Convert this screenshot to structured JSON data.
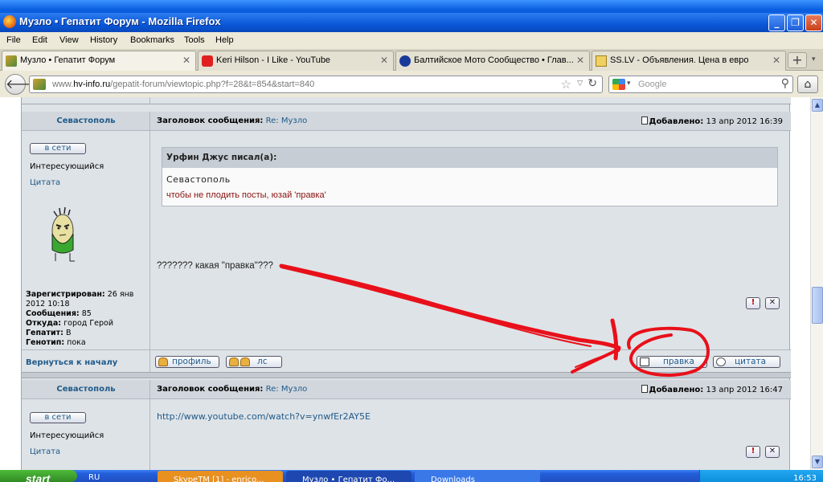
{
  "window": {
    "title": "Музло • Гепатит Форум - Mozilla Firefox"
  },
  "menu": [
    "File",
    "Edit",
    "View",
    "History",
    "Bookmarks",
    "Tools",
    "Help"
  ],
  "tabs": [
    {
      "label": "Музло • Гепатит Форум",
      "active": true
    },
    {
      "label": "Keri Hilson - I Like - YouTube",
      "active": false
    },
    {
      "label": "Балтийское Мото Сообщество • Глав...",
      "active": false
    },
    {
      "label": "SS.LV - Объявления. Цена в евро",
      "active": false
    }
  ],
  "nav": {
    "url_prefix": "www.",
    "url_domain": "hv-info.ru",
    "url_path": "/gepatit-forum/viewtopic.php?f=28&t=854&start=840",
    "search_placeholder": "Google"
  },
  "post1": {
    "author": "Севастополь",
    "subject_label": "Заголовок сообщения:",
    "subject": "Re: Музло",
    "date_label": "Добавлено:",
    "date": "13 апр 2012 16:39",
    "status": "в сети",
    "rank": "Интересующийся",
    "quote_link": "Цитата",
    "stats": {
      "registered_label": "Зарегистрирован:",
      "registered": "26 янв 2012 10:18",
      "posts_label": "Сообщения:",
      "posts": "85",
      "from_label": "Откуда:",
      "from": "город Герой",
      "hepatitis_label": "Гепатит:",
      "hepatitis": "B",
      "genotype_label": "Генотип:",
      "genotype": "пока"
    },
    "quote_header": "Урфин Джус писал(а):",
    "quote_author": "Севастополь",
    "quote_text": "чтобы не плодить посты, юзай 'правка'",
    "body": "??????? какая \"правка\"???"
  },
  "actions": {
    "back_to_top": "Вернуться к началу",
    "profile": "профиль",
    "pm": "лс",
    "edit": "правка",
    "quote": "цитата"
  },
  "post2": {
    "author": "Севастополь",
    "subject_label": "Заголовок сообщения:",
    "subject": "Re: Музло",
    "date_label": "Добавлено:",
    "date": "13 апр 2012 16:47",
    "status": "в сети",
    "rank": "Интересующийся",
    "quote_link": "Цитата",
    "body_link": "http://www.youtube.com/watch?v=ynwfEr2AY5E"
  },
  "taskbar": {
    "start": "start",
    "lang": "RU",
    "items": [
      "SkypeTM [1] - enrico...",
      "Музло • Гепатит Фо...",
      "Downloads"
    ],
    "clock": "16:53"
  },
  "colors": {
    "annotation": "#e8101a",
    "link": "#1f5a8a"
  }
}
